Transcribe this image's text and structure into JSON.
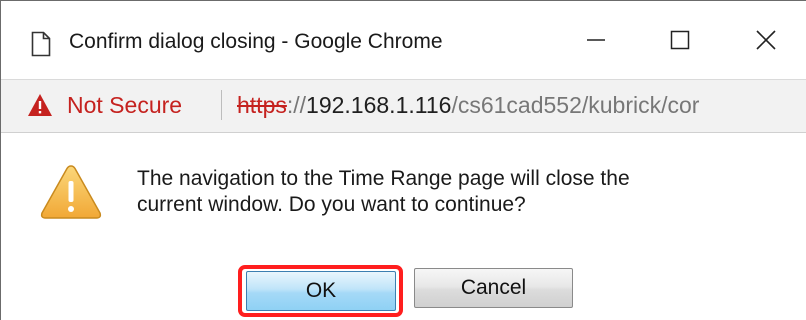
{
  "window": {
    "title": "Confirm dialog closing - Google Chrome",
    "icon": "document-icon"
  },
  "window_controls": {
    "minimize_icon": "minimize-icon",
    "maximize_icon": "maximize-icon",
    "close_icon": "close-icon"
  },
  "address_bar": {
    "warning_icon": "warning-triangle-icon",
    "security_label": "Not Secure",
    "url_scheme": "https",
    "url_separator": "://",
    "url_host": "192.168.1.116",
    "url_path": "/cs61cad552/kubrick/cor",
    "warning_color": "#c5221f"
  },
  "dialog": {
    "icon": "warning-icon",
    "message_line1": "The navigation to the Time Range page will close the",
    "message_line2": "current window. Do you want to continue?",
    "ok_label": "OK",
    "cancel_label": "Cancel",
    "highlight_color": "#ff1e1e"
  }
}
